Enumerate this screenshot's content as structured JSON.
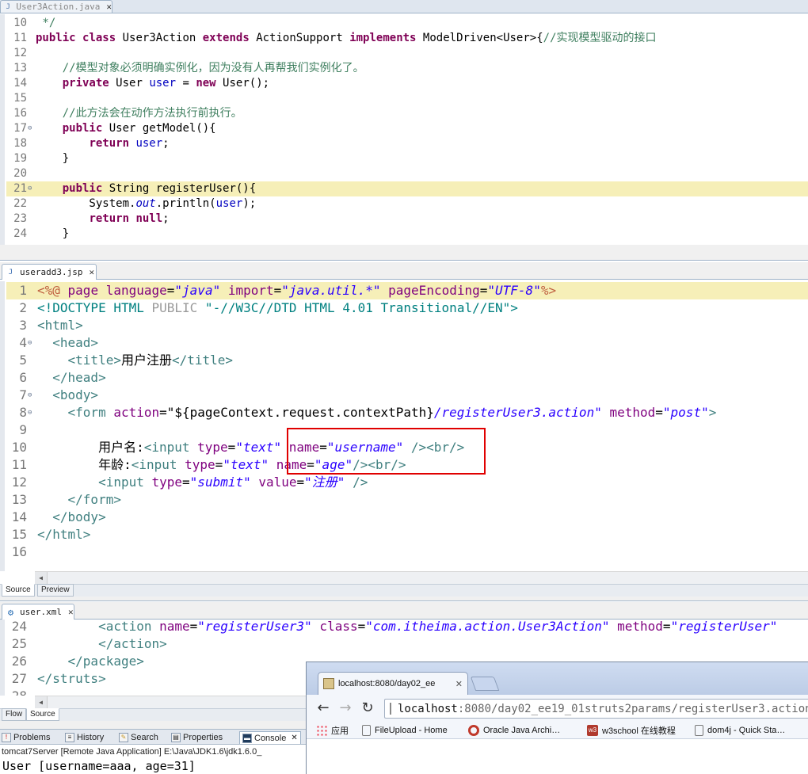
{
  "java_editor": {
    "tab_label": "User3Action.java",
    "lines": [
      {
        "n": "10",
        "tokens": [
          {
            "c": "cm",
            "t": " */"
          }
        ]
      },
      {
        "n": "11",
        "tokens": [
          {
            "c": "kw",
            "t": "public"
          },
          {
            "c": "ty",
            "t": " "
          },
          {
            "c": "kw",
            "t": "class"
          },
          {
            "c": "ty",
            "t": " User3Action "
          },
          {
            "c": "kw",
            "t": "extends"
          },
          {
            "c": "ty",
            "t": " ActionSupport "
          },
          {
            "c": "kw",
            "t": "implements"
          },
          {
            "c": "ty",
            "t": " ModelDriven<User>{"
          },
          {
            "c": "cm",
            "t": "//实现模型驱动的接口"
          }
        ]
      },
      {
        "n": "12",
        "tokens": []
      },
      {
        "n": "13",
        "tokens": [
          {
            "c": "cm",
            "t": "    //模型对象必须明确实例化，因为没有人再帮我们实例化了。"
          }
        ]
      },
      {
        "n": "14",
        "tokens": [
          {
            "c": "ty",
            "t": "    "
          },
          {
            "c": "kw",
            "t": "private"
          },
          {
            "c": "ty",
            "t": " User "
          },
          {
            "c": "fld",
            "t": "user"
          },
          {
            "c": "ty",
            "t": " = "
          },
          {
            "c": "kw",
            "t": "new"
          },
          {
            "c": "ty",
            "t": " User();"
          }
        ]
      },
      {
        "n": "15",
        "tokens": []
      },
      {
        "n": "16",
        "tokens": [
          {
            "c": "cm",
            "t": "    //此方法会在动作方法执行前执行。"
          }
        ]
      },
      {
        "n": "17",
        "tokens": [
          {
            "c": "ty",
            "t": "    "
          },
          {
            "c": "kw",
            "t": "public"
          },
          {
            "c": "ty",
            "t": " User getModel(){"
          }
        ]
      },
      {
        "n": "18",
        "tokens": [
          {
            "c": "ty",
            "t": "        "
          },
          {
            "c": "kw",
            "t": "return"
          },
          {
            "c": "ty",
            "t": " "
          },
          {
            "c": "fld",
            "t": "user"
          },
          {
            "c": "ty",
            "t": ";"
          }
        ]
      },
      {
        "n": "19",
        "tokens": [
          {
            "c": "ty",
            "t": "    }"
          }
        ]
      },
      {
        "n": "20",
        "tokens": []
      },
      {
        "n": "21",
        "tokens": [
          {
            "c": "ty",
            "t": "    "
          },
          {
            "c": "kw",
            "t": "public"
          },
          {
            "c": "ty",
            "t": " String registerUser(){"
          }
        ]
      },
      {
        "n": "22",
        "tokens": [
          {
            "c": "ty",
            "t": "        System."
          },
          {
            "c": "st",
            "t": "out"
          },
          {
            "c": "ty",
            "t": ".println("
          },
          {
            "c": "fld",
            "t": "user"
          },
          {
            "c": "ty",
            "t": ");"
          }
        ]
      },
      {
        "n": "23",
        "tokens": [
          {
            "c": "ty",
            "t": "        "
          },
          {
            "c": "kw",
            "t": "return"
          },
          {
            "c": "ty",
            "t": " "
          },
          {
            "c": "kw",
            "t": "null"
          },
          {
            "c": "ty",
            "t": ";"
          }
        ]
      },
      {
        "n": "24",
        "tokens": [
          {
            "c": "ty",
            "t": "    }"
          }
        ]
      }
    ]
  },
  "jsp_editor": {
    "tab_label": "useradd3.jsp",
    "lines": [
      {
        "n": "1",
        "tokens": [
          {
            "c": "dir",
            "t": "<%@"
          },
          {
            "c": "attr",
            "t": " page language"
          },
          {
            "c": "txt",
            "t": "="
          },
          {
            "c": "val",
            "t": "\"java\""
          },
          {
            "c": "attr",
            "t": " import"
          },
          {
            "c": "txt",
            "t": "="
          },
          {
            "c": "val",
            "t": "\"java.util.*\""
          },
          {
            "c": "attr",
            "t": " pageEncoding"
          },
          {
            "c": "txt",
            "t": "="
          },
          {
            "c": "val",
            "t": "\"UTF-8\""
          },
          {
            "c": "dir",
            "t": "%>"
          }
        ]
      },
      {
        "n": "2",
        "tokens": [
          {
            "c": "doctype",
            "t": "<!DOCTYPE HTML "
          },
          {
            "c": "dim",
            "t": "PUBLIC"
          },
          {
            "c": "doctype",
            "t": " \"-//W3C//DTD HTML 4.01 Transitional//EN\">"
          }
        ]
      },
      {
        "n": "3",
        "tokens": [
          {
            "c": "tag",
            "t": "<html>"
          }
        ]
      },
      {
        "n": "4",
        "tokens": [
          {
            "c": "tag",
            "t": "  <head>"
          }
        ]
      },
      {
        "n": "5",
        "tokens": [
          {
            "c": "tag",
            "t": "    <title>"
          },
          {
            "c": "txt",
            "t": "用户注册"
          },
          {
            "c": "tag",
            "t": "</title>"
          }
        ]
      },
      {
        "n": "6",
        "tokens": [
          {
            "c": "tag",
            "t": "  </head>"
          }
        ]
      },
      {
        "n": "7",
        "tokens": [
          {
            "c": "tag",
            "t": "  <body>"
          }
        ]
      },
      {
        "n": "8",
        "tokens": [
          {
            "c": "tag",
            "t": "    <form "
          },
          {
            "c": "attr",
            "t": "action"
          },
          {
            "c": "txt",
            "t": "=\"${pageContext.request.contextPath}"
          },
          {
            "c": "val",
            "t": "/registerUser3.action\""
          },
          {
            "c": "attr",
            "t": " method"
          },
          {
            "c": "txt",
            "t": "="
          },
          {
            "c": "val",
            "t": "\"post\""
          },
          {
            "c": "tag",
            "t": ">"
          }
        ]
      },
      {
        "n": "9",
        "tokens": []
      },
      {
        "n": "10",
        "tokens": [
          {
            "c": "txt",
            "t": "        用户名:"
          },
          {
            "c": "tag",
            "t": "<input "
          },
          {
            "c": "attr",
            "t": "type"
          },
          {
            "c": "txt",
            "t": "="
          },
          {
            "c": "val",
            "t": "\"text\""
          },
          {
            "c": "attr",
            "t": " name"
          },
          {
            "c": "txt",
            "t": "="
          },
          {
            "c": "val",
            "t": "\"username\""
          },
          {
            "c": "tag",
            "t": " /><br/>"
          }
        ]
      },
      {
        "n": "11",
        "tokens": [
          {
            "c": "txt",
            "t": "        年龄:"
          },
          {
            "c": "tag",
            "t": "<input "
          },
          {
            "c": "attr",
            "t": "type"
          },
          {
            "c": "txt",
            "t": "="
          },
          {
            "c": "val",
            "t": "\"text\""
          },
          {
            "c": "attr",
            "t": " name"
          },
          {
            "c": "txt",
            "t": "="
          },
          {
            "c": "val",
            "t": "\"age\""
          },
          {
            "c": "tag",
            "t": "/><br/>"
          }
        ]
      },
      {
        "n": "12",
        "tokens": [
          {
            "c": "tag",
            "t": "        <input "
          },
          {
            "c": "attr",
            "t": "type"
          },
          {
            "c": "txt",
            "t": "="
          },
          {
            "c": "val",
            "t": "\"submit\""
          },
          {
            "c": "attr",
            "t": " value"
          },
          {
            "c": "txt",
            "t": "="
          },
          {
            "c": "val",
            "t": "\"注册\""
          },
          {
            "c": "tag",
            "t": " />"
          }
        ]
      },
      {
        "n": "13",
        "tokens": [
          {
            "c": "tag",
            "t": "    </form>"
          }
        ]
      },
      {
        "n": "14",
        "tokens": [
          {
            "c": "tag",
            "t": "  </body>"
          }
        ]
      },
      {
        "n": "15",
        "tokens": [
          {
            "c": "tag",
            "t": "</html>"
          }
        ]
      },
      {
        "n": "16",
        "tokens": []
      }
    ],
    "subtabs": {
      "source": "Source",
      "preview": "Preview"
    }
  },
  "xml_editor": {
    "tab_label": "user.xml",
    "lines": [
      {
        "n": "24",
        "tokens": [
          {
            "c": "tag",
            "t": "        <action "
          },
          {
            "c": "attr",
            "t": "name"
          },
          {
            "c": "txt",
            "t": "="
          },
          {
            "c": "val",
            "t": "\"registerUser3\""
          },
          {
            "c": "attr",
            "t": " class"
          },
          {
            "c": "txt",
            "t": "="
          },
          {
            "c": "val",
            "t": "\"com.itheima.action.User3Action\""
          },
          {
            "c": "attr",
            "t": " method"
          },
          {
            "c": "txt",
            "t": "="
          },
          {
            "c": "val",
            "t": "\"registerUser\""
          }
        ]
      },
      {
        "n": "25",
        "tokens": [
          {
            "c": "tag",
            "t": "        </action>"
          }
        ]
      },
      {
        "n": "26",
        "tokens": [
          {
            "c": "tag",
            "t": "    </package>"
          }
        ]
      },
      {
        "n": "27",
        "tokens": [
          {
            "c": "tag",
            "t": "</struts>"
          }
        ]
      },
      {
        "n": "28",
        "tokens": []
      }
    ],
    "subtabs": {
      "flow": "Flow",
      "source": "Source"
    }
  },
  "bottom_panel": {
    "tabs": [
      {
        "label": "Problems",
        "icon": "problems-icon"
      },
      {
        "label": "History",
        "icon": "history-icon"
      },
      {
        "label": "Search",
        "icon": "search-icon"
      },
      {
        "label": "Properties",
        "icon": "properties-icon"
      },
      {
        "label": "Console",
        "icon": "console-icon"
      }
    ],
    "console_header": "tomcat7Server [Remote Java Application] E:\\Java\\JDK1.6\\jdk1.6.0_",
    "console_output": "User [username=aaa, age=31]"
  },
  "browser": {
    "tab_title": "localhost:8080/day02_ee",
    "url_host": "localhost",
    "url_path": ":8080/day02_ee19_01struts2params/registerUser3.action",
    "bookmarks": [
      {
        "label": "应用",
        "icon": "apps-icon",
        "color": "#d9534f"
      },
      {
        "label": "FileUpload - Home",
        "icon": "page-icon",
        "color": "#ffffff"
      },
      {
        "label": "Oracle Java Archi…",
        "icon": "oracle-icon",
        "color": "#c0392b"
      },
      {
        "label": "w3school 在线教程",
        "icon": "w3school-icon",
        "color": "#b03a2e"
      },
      {
        "label": "dom4j - Quick Sta…",
        "icon": "page-icon",
        "color": "#ffffff"
      }
    ]
  }
}
